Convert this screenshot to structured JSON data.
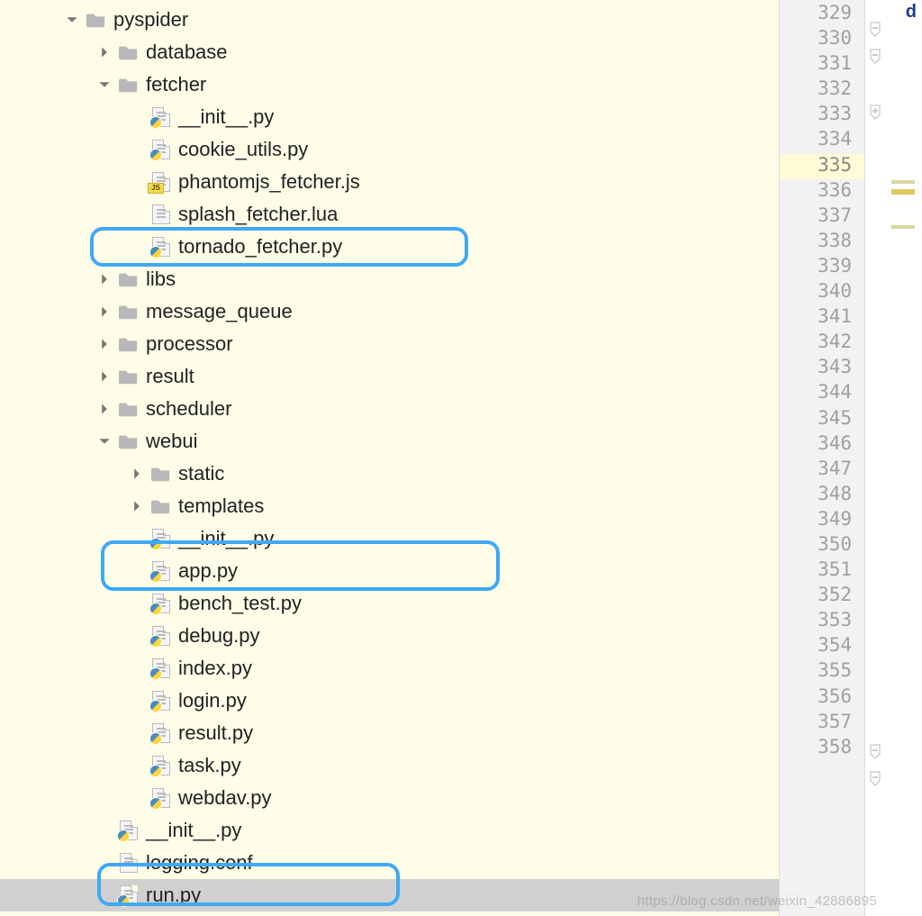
{
  "tree": {
    "root": "pyspider",
    "database": "database",
    "fetcher": "fetcher",
    "fetcher_init": "__init__.py",
    "cookie_utils": "cookie_utils.py",
    "phantomjs": "phantomjs_fetcher.js",
    "splash": "splash_fetcher.lua",
    "tornado": "tornado_fetcher.py",
    "libs": "libs",
    "message_queue": "message_queue",
    "processor": "processor",
    "result": "result",
    "scheduler": "scheduler",
    "webui": "webui",
    "static": "static",
    "templates": "templates",
    "webui_init": "__init__.py",
    "app": "app.py",
    "bench_test": "bench_test.py",
    "debug": "debug.py",
    "index": "index.py",
    "login": "login.py",
    "result_py": "result.py",
    "task": "task.py",
    "webdav": "webdav.py",
    "root_init": "__init__.py",
    "logging_conf": "logging.conf",
    "run": "run.py",
    "js_badge": "JS"
  },
  "line_numbers": {
    "start": 329,
    "end": 358,
    "current": 335
  },
  "corner_label": "d",
  "watermark": "https://blog.csdn.net/weixin_42886895"
}
